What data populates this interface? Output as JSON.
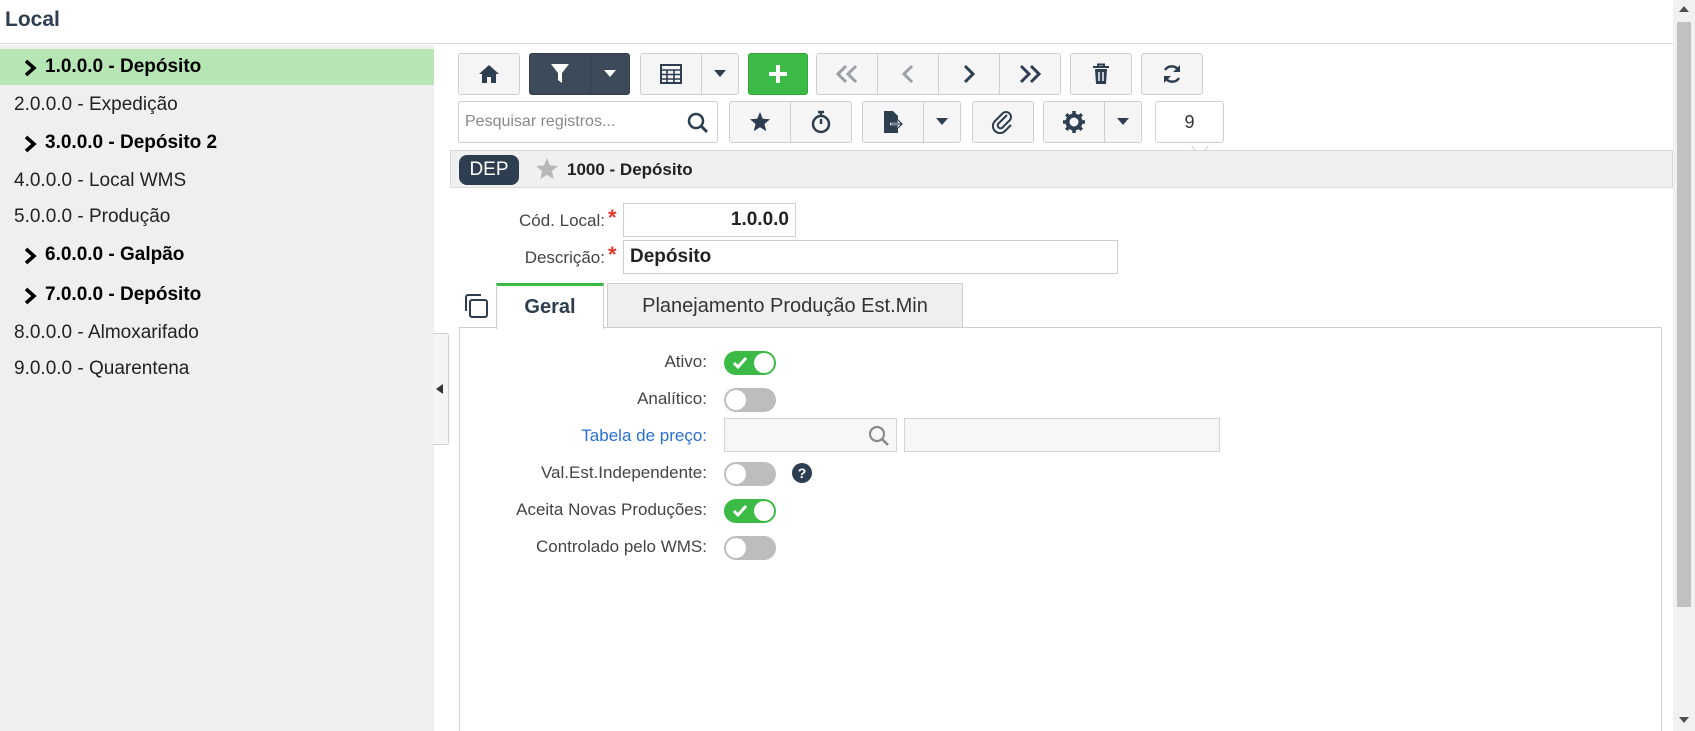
{
  "window": {
    "title": "Local"
  },
  "tree": {
    "items": [
      {
        "label": "1.0.0.0 - Depósito",
        "expandable": true,
        "active": true
      },
      {
        "label": "2.0.0.0 - Expedição",
        "expandable": false
      },
      {
        "label": "3.0.0.0 - Depósito 2",
        "expandable": true
      },
      {
        "label": "4.0.0.0 - Local WMS",
        "expandable": false
      },
      {
        "label": "5.0.0.0 - Produção",
        "expandable": false
      },
      {
        "label": "6.0.0.0 - Galpão",
        "expandable": true
      },
      {
        "label": "7.0.0.0 - Depósito",
        "expandable": true
      },
      {
        "label": "8.0.0.0 - Almoxarifado",
        "expandable": false
      },
      {
        "label": "9.0.0.0 - Quarentena",
        "expandable": false
      }
    ]
  },
  "toolbar": {
    "icons": [
      "home-icon",
      "filter-icon",
      "grid-icon",
      "plus-icon",
      "first-icon",
      "prev-icon",
      "next-icon",
      "last-icon",
      "trash-icon",
      "refresh-icon",
      "star-icon",
      "timer-icon",
      "export-icon",
      "paperclip-icon",
      "gear-icon"
    ],
    "accent_green": "#3bbb46",
    "dark_button": "#3c4a5a"
  },
  "search": {
    "placeholder": "Pesquisar registros..."
  },
  "record_count": "9",
  "record": {
    "badge": "DEP",
    "title": "1000 - Depósito"
  },
  "form": {
    "cod_local_label": "Cód. Local:",
    "cod_local_value": "1.0.0.0",
    "descricao_label": "Descrição:",
    "descricao_value": "Depósito",
    "required_mark": "*"
  },
  "tabs": [
    {
      "label": "Geral",
      "active": true
    },
    {
      "label": "Planejamento Produção Est.Min",
      "active": false
    }
  ],
  "geral": {
    "ativo_label": "Ativo:",
    "ativo": true,
    "analitico_label": "Analítico:",
    "analitico": false,
    "tabela_preco_label": "Tabela de preço:",
    "val_est_label": "Val.Est.Independente:",
    "val_est": false,
    "help_mark": "?",
    "aceita_label": "Aceita Novas Produções:",
    "aceita": true,
    "wms_label": "Controlado pelo WMS:",
    "wms": false
  }
}
